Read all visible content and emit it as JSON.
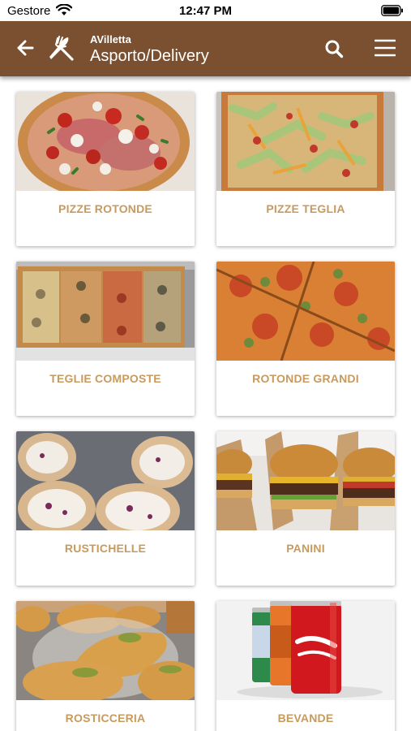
{
  "status_bar": {
    "carrier": "Gestore",
    "time": "12:47 PM"
  },
  "header": {
    "subtitle": "AVilletta",
    "title": "Asporto/Delivery",
    "background_color": "#7a5030"
  },
  "categories": [
    {
      "label": "PIZZE ROTONDE",
      "image": "round-pizza-photo"
    },
    {
      "label": "PIZZE TEGLIA",
      "image": "tray-pizza-photo"
    },
    {
      "label": "TEGLIE COMPOSTE",
      "image": "mixed-tray-pizza-photo"
    },
    {
      "label": "ROTONDE GRANDI",
      "image": "large-round-pizza-photo"
    },
    {
      "label": "RUSTICHELLE",
      "image": "rolled-pastry-photo"
    },
    {
      "label": "PANINI",
      "image": "burgers-photo"
    },
    {
      "label": "ROSTICCERIA",
      "image": "fried-pastries-photo"
    },
    {
      "label": "BEVANDE",
      "image": "soda-cans-photo"
    }
  ],
  "accent_color": "#c79a5e"
}
